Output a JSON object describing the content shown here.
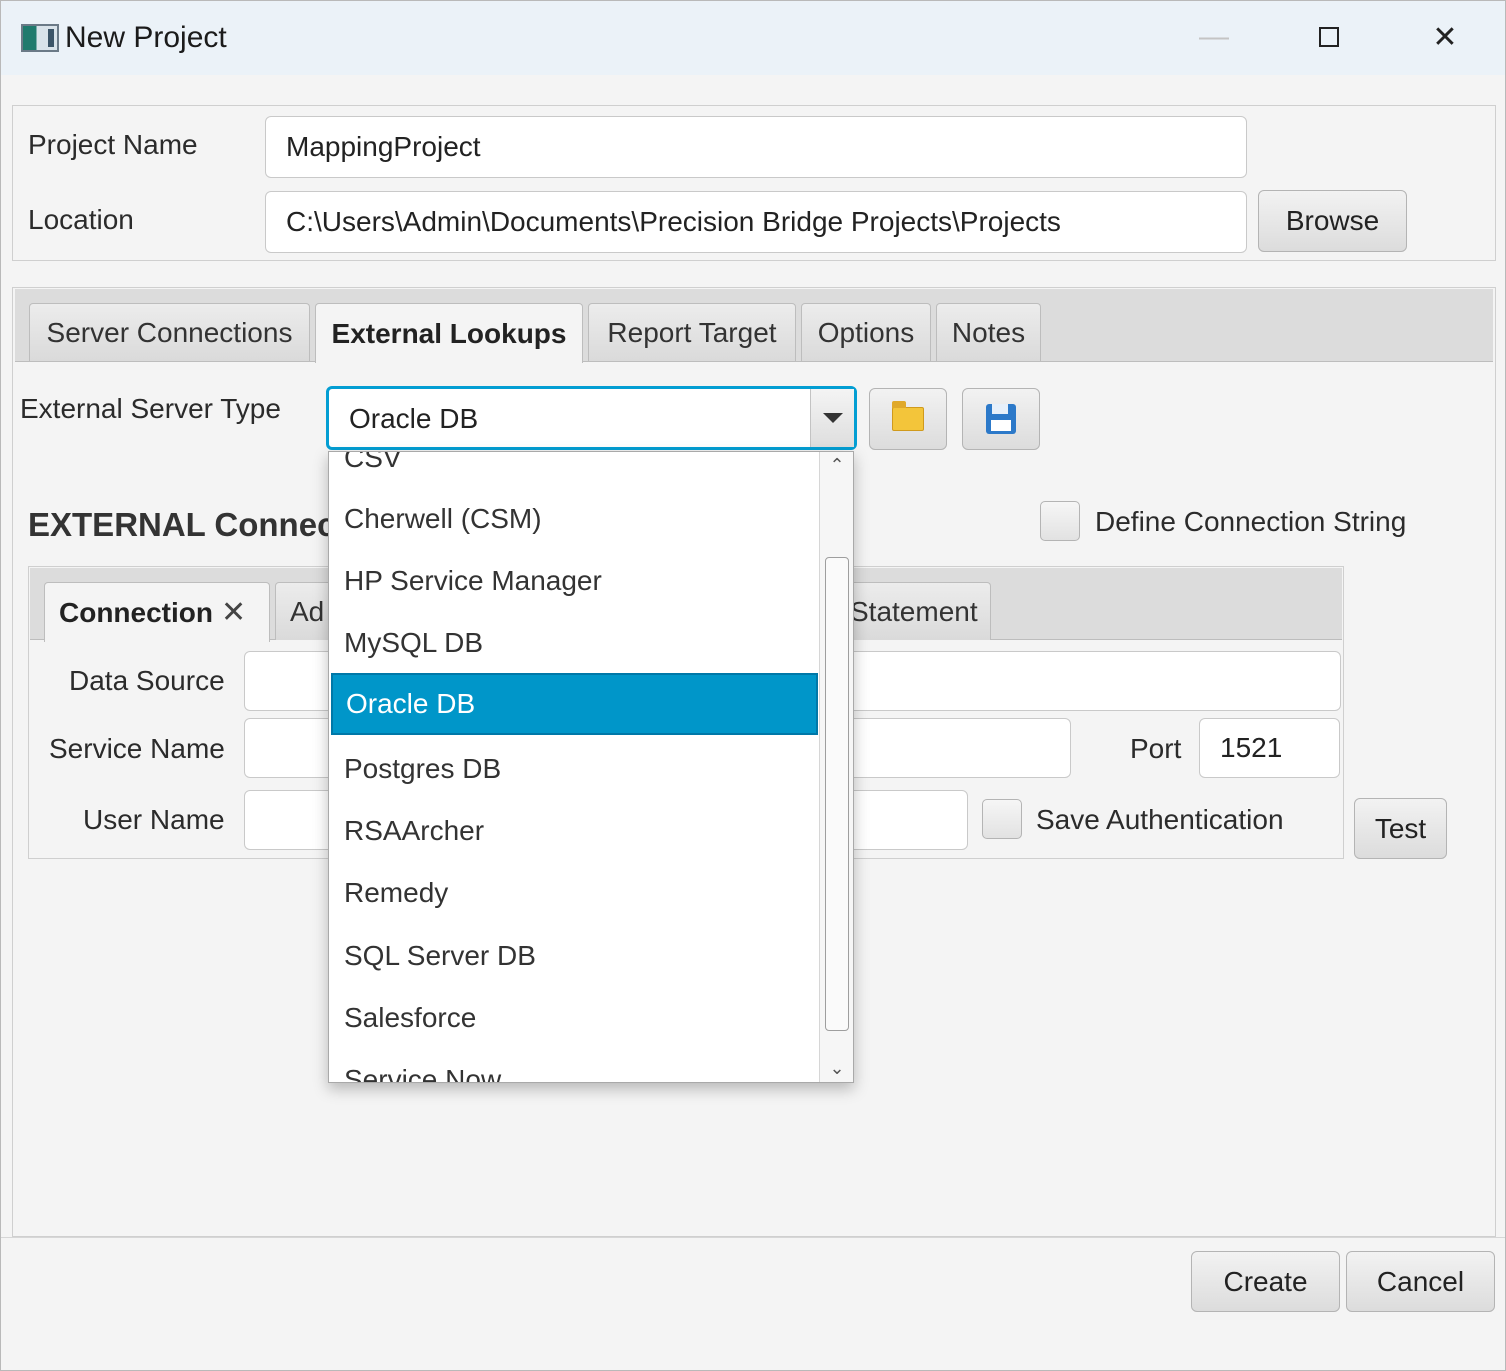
{
  "window": {
    "title": "New Project",
    "app_icon": "app-icon",
    "minimize": "—",
    "close": "✕"
  },
  "header": {
    "project_name_label": "Project Name",
    "project_name_value": "MappingProject",
    "location_label": "Location",
    "location_value": "C:\\Users\\Admin\\Documents\\Precision Bridge Projects\\Projects",
    "browse_label": "Browse"
  },
  "tabs": [
    {
      "label": "Server Connections"
    },
    {
      "label": "External Lookups"
    },
    {
      "label": "Report Target"
    },
    {
      "label": "Options"
    },
    {
      "label": "Notes"
    }
  ],
  "external": {
    "server_type_label": "External Server Type",
    "server_type_value": "Oracle DB",
    "section_title": "EXTERNAL Connec",
    "define_conn_label": "Define Connection String",
    "inner_tabs": [
      {
        "label": "Connection",
        "close": "✕"
      },
      {
        "label": "Ad"
      },
      {
        "label": "Statement"
      }
    ],
    "data_source_label": "Data Source",
    "service_name_label": "Service Name",
    "port_label": "Port",
    "port_value": "1521",
    "user_name_label": "User Name",
    "save_auth_label": "Save Authentication",
    "test_label": "Test"
  },
  "dropdown": {
    "items": [
      "CSV",
      "Cherwell (CSM)",
      "HP Service Manager",
      "MySQL DB",
      "Oracle DB",
      "Postgres DB",
      "RSAArcher",
      "Remedy",
      "SQL Server DB",
      "Salesforce",
      "Service Now"
    ],
    "selected": "Oracle DB"
  },
  "footer": {
    "create_label": "Create",
    "cancel_label": "Cancel"
  },
  "colors": {
    "accent": "#0096c9",
    "focus_border": "#039ed3",
    "titlebar": "#ebf2f8"
  }
}
